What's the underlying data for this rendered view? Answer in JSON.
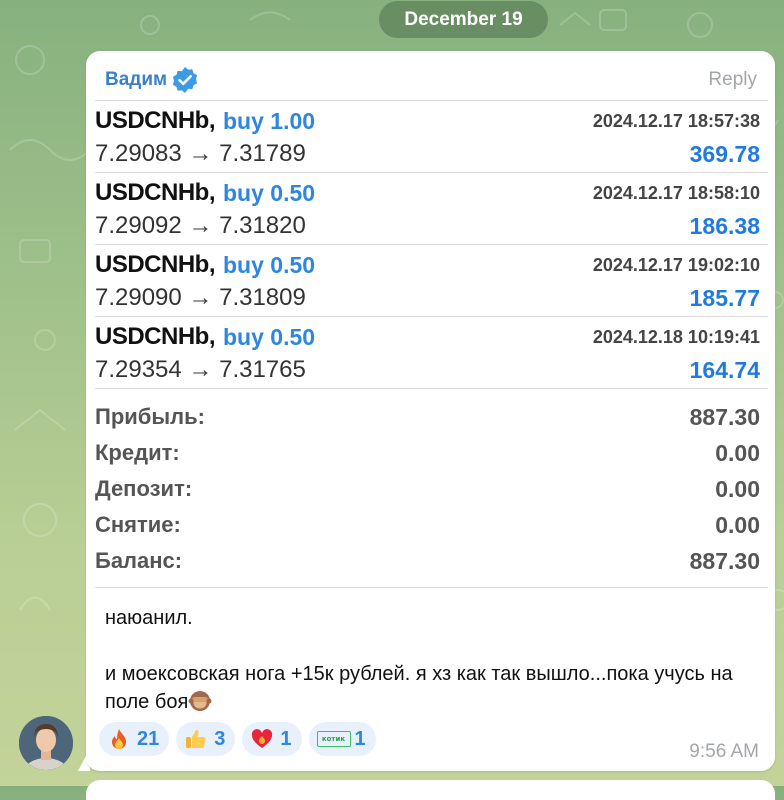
{
  "date_separator": "December 19",
  "message": {
    "sender": "Вадим",
    "reply_label": "Reply",
    "time": "9:56 AM",
    "text_line1": "наюанил.",
    "text_line2": "и моексовская нога +15к рублей. я хз как так вышло...пока учусь на поле боя"
  },
  "report": {
    "trades": [
      {
        "symbol": "USDCNHb,",
        "side": "buy 1.00",
        "time": "2024.12.17 18:57:38",
        "prices": "7.29083 → 7.31789",
        "profit": "369.78"
      },
      {
        "symbol": "USDCNHb,",
        "side": "buy 0.50",
        "time": "2024.12.17 18:58:10",
        "prices": "7.29092 → 7.31820",
        "profit": "186.38"
      },
      {
        "symbol": "USDCNHb,",
        "side": "buy 0.50",
        "time": "2024.12.17 19:02:10",
        "prices": "7.29090 → 7.31809",
        "profit": "185.77"
      },
      {
        "symbol": "USDCNHb,",
        "side": "buy 0.50",
        "time": "2024.12.18 10:19:41",
        "prices": "7.29354 → 7.31765",
        "profit": "164.74"
      }
    ],
    "summary": [
      {
        "label": "Прибыль:",
        "value": "887.30"
      },
      {
        "label": "Кредит:",
        "value": "0.00"
      },
      {
        "label": "Депозит:",
        "value": "0.00"
      },
      {
        "label": "Снятие:",
        "value": "0.00"
      },
      {
        "label": "Баланс:",
        "value": "887.30"
      }
    ]
  },
  "reactions": [
    {
      "icon": "fire-icon",
      "count": "21"
    },
    {
      "icon": "thumbs-up-icon",
      "count": "3"
    },
    {
      "icon": "heart-on-fire-icon",
      "count": "1"
    },
    {
      "icon": "sticker-icon",
      "sticker_text": "котик",
      "count": "1"
    }
  ],
  "colors": {
    "accent": "#2e86de",
    "sender": "#3a80c9",
    "meta": "#a3a7ab",
    "wallpaper": "#9fc08a"
  }
}
